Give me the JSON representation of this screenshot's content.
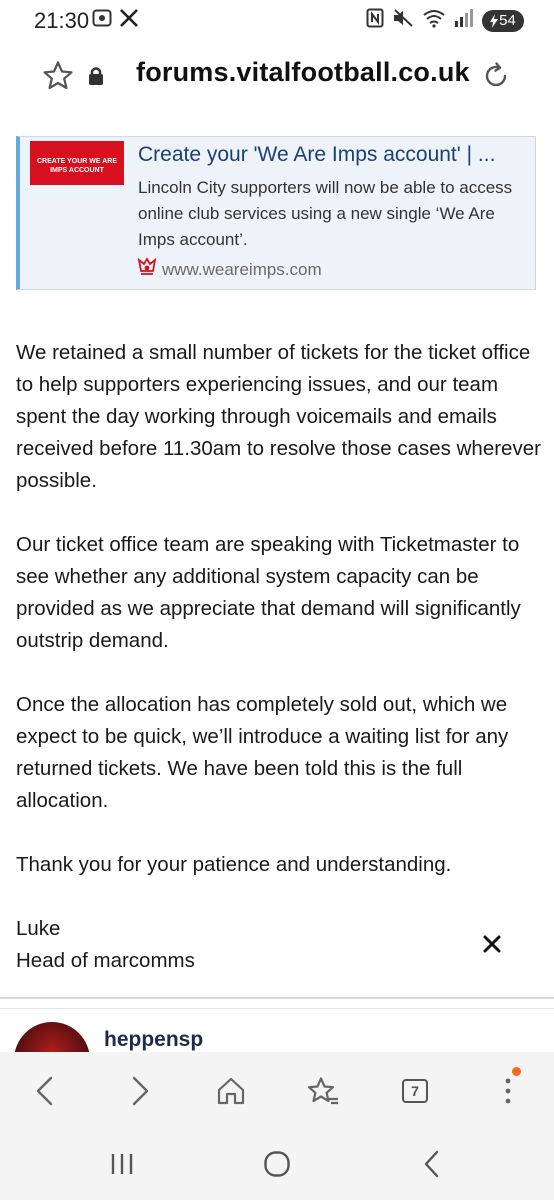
{
  "status_bar": {
    "time": "21:30",
    "battery_level": "54",
    "left_icons": [
      "screenshot-icon",
      "x-logo-icon"
    ],
    "right_icons": [
      "nfc-icon",
      "mute-icon",
      "wifi-icon",
      "signal-icon",
      "battery-charging-icon"
    ]
  },
  "browser": {
    "url": "forums.vitalfootball.co.uk",
    "tab_count": "7"
  },
  "preview": {
    "thumbnail_text": "CREATE YOUR WE ARE IMPS ACCOUNT",
    "title": "Create your 'We Are Imps account' | ...",
    "description": "Lincoln City supporters will now be able to access online club services using a new single ‘We Are Imps account’.",
    "domain": "www.weareimps.com",
    "brand_color": "#d7101f"
  },
  "article": {
    "paragraphs": [
      "We retained a small number of tickets for the ticket office to help supporters experiencing issues, and our team spent the day working through voicemails and emails received before 11.30am to resolve those cases wherever possible.",
      "Our ticket office team are speaking with Ticketmaster to see whether any additional system capacity can be provided as we appreciate that demand will significantly outstrip demand.",
      "Once the allocation has completely sold out, which we expect to be quick, we’ll introduce a waiting list for any returned tickets. We have been told this is the full allocation.",
      "Thank you for your patience and understanding."
    ],
    "signature_name": "Luke",
    "signature_role": "Head of marcomms"
  },
  "next_post": {
    "username": "heppensp"
  },
  "colors": {
    "accent_border": "#64a9dd",
    "title_blue": "#1d3f73",
    "notification_dot": "#f36b1c"
  }
}
